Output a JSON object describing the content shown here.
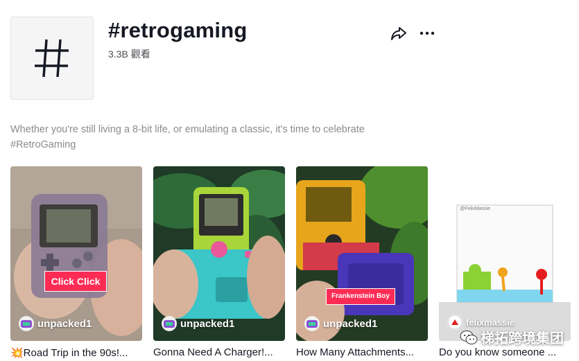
{
  "header": {
    "title": "#retrogaming",
    "views": "3.3B 觀看",
    "hash_icon": "hashtag-icon",
    "share_icon": "share-icon",
    "more_icon": "more-icon"
  },
  "description": "Whether you're still living a 8-bit life, or emulating a classic, it's time to celebrate #RetroGaming",
  "videos": [
    {
      "user": "unpacked1",
      "caption": "💥Road Trip in the 90s!...",
      "sticker": "Click Click"
    },
    {
      "user": "unpacked1",
      "caption": "Gonna Need A Charger!..."
    },
    {
      "user": "unpacked1",
      "caption": "How Many Attachments...",
      "sticker": "Frankenstein Boy"
    },
    {
      "user": "felixmassie",
      "caption": "Do you know someone ...",
      "frame_label": "@FelixMassie"
    }
  ],
  "watermark": "梯拓跨境集团",
  "colors": {
    "accent": "#fe2c55",
    "text": "#161823",
    "muted": "#8a8b91"
  }
}
